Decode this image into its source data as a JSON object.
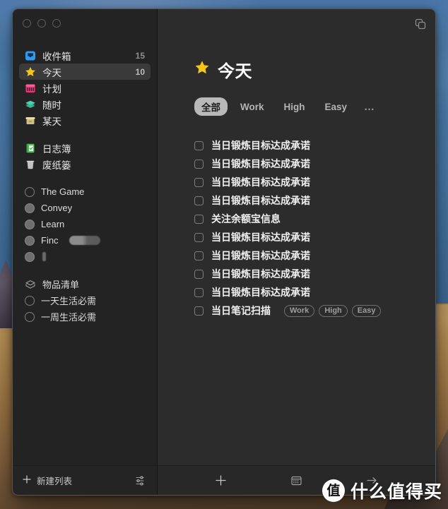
{
  "window": {
    "traffic_lights": [
      "close",
      "minimize",
      "zoom"
    ],
    "titlebar_right_icon": "stacked-windows-icon"
  },
  "sidebar": {
    "groups": [
      {
        "items": [
          {
            "label": "收件箱",
            "count": "15",
            "icon": "inbox-icon",
            "icon_color": "#2e9bf0",
            "selected": false
          },
          {
            "label": "今天",
            "count": "10",
            "icon": "star-icon",
            "icon_color": "#f5c518",
            "selected": true
          },
          {
            "label": "计划",
            "count": "",
            "icon": "calendar-icon",
            "icon_color": "#f0337a",
            "selected": false
          },
          {
            "label": "随时",
            "count": "",
            "icon": "layers-icon",
            "icon_color": "#3fc39b",
            "selected": false
          },
          {
            "label": "某天",
            "count": "",
            "icon": "box-icon",
            "icon_color": "#d9cb92",
            "selected": false
          }
        ]
      },
      {
        "items": [
          {
            "label": "日志簿",
            "count": "",
            "icon": "logbook-icon",
            "icon_color": "#4ec15a",
            "selected": false
          },
          {
            "label": "废纸篓",
            "count": "",
            "icon": "trash-icon",
            "icon_color": "#b9b9b9",
            "selected": false
          }
        ]
      },
      {
        "items": [
          {
            "label": "The Game",
            "count": "",
            "icon": "project-circle-icon",
            "filled": false,
            "selected": false
          },
          {
            "label": "Convey",
            "count": "",
            "icon": "project-circle-icon",
            "filled": true,
            "selected": false
          },
          {
            "label": "Learn",
            "count": "",
            "icon": "project-circle-icon",
            "filled": true,
            "selected": false
          },
          {
            "label": "Finc",
            "count": "",
            "icon": "project-circle-icon",
            "filled": true,
            "selected": false,
            "redacted": true
          },
          {
            "label": "",
            "count": "",
            "icon": "project-circle-icon",
            "filled": true,
            "selected": false,
            "redacted_small": true
          }
        ]
      },
      {
        "items": [
          {
            "label": "物品清单",
            "count": "",
            "icon": "area-icon",
            "selected": false
          },
          {
            "label": "一天生活必需",
            "count": "",
            "icon": "project-circle-icon",
            "filled": false,
            "selected": false
          },
          {
            "label": "一周生活必需",
            "count": "",
            "icon": "project-circle-icon",
            "filled": false,
            "selected": false
          }
        ]
      }
    ]
  },
  "main": {
    "title": "今天",
    "title_icon": "star-icon",
    "filters": [
      {
        "label": "全部",
        "active": true
      },
      {
        "label": "Work",
        "active": false
      },
      {
        "label": "High",
        "active": false
      },
      {
        "label": "Easy",
        "active": false
      },
      {
        "label": "…",
        "active": false,
        "is_dots": true
      }
    ],
    "tasks": [
      {
        "title": "当日锻炼目标达成承诺",
        "checked": false,
        "tags": []
      },
      {
        "title": "当日锻炼目标达成承诺",
        "checked": false,
        "tags": []
      },
      {
        "title": "当日锻炼目标达成承诺",
        "checked": false,
        "tags": []
      },
      {
        "title": "当日锻炼目标达成承诺",
        "checked": false,
        "tags": []
      },
      {
        "title": "关注余额宝信息",
        "checked": false,
        "tags": []
      },
      {
        "title": "当日锻炼目标达成承诺",
        "checked": false,
        "tags": []
      },
      {
        "title": "当日锻炼目标达成承诺",
        "checked": false,
        "tags": []
      },
      {
        "title": "当日锻炼目标达成承诺",
        "checked": false,
        "tags": []
      },
      {
        "title": "当日锻炼目标达成承诺",
        "checked": false,
        "tags": []
      },
      {
        "title": "当日笔记扫描",
        "checked": false,
        "tags": [
          "Work",
          "High",
          "Easy"
        ]
      }
    ]
  },
  "toolbar": {
    "new_list_label": "新建列表",
    "new_list_icon": "plus-icon",
    "settings_icon": "sliders-icon",
    "add_icon": "plus-icon",
    "calendar_icon": "calendar-icon",
    "move_icon": "move-icon"
  },
  "annotation": {
    "arrow": "yellow-arrow-up-left",
    "arrow_color": "#f5e400"
  },
  "watermark": {
    "badge": "值",
    "text": "什么值得买"
  }
}
